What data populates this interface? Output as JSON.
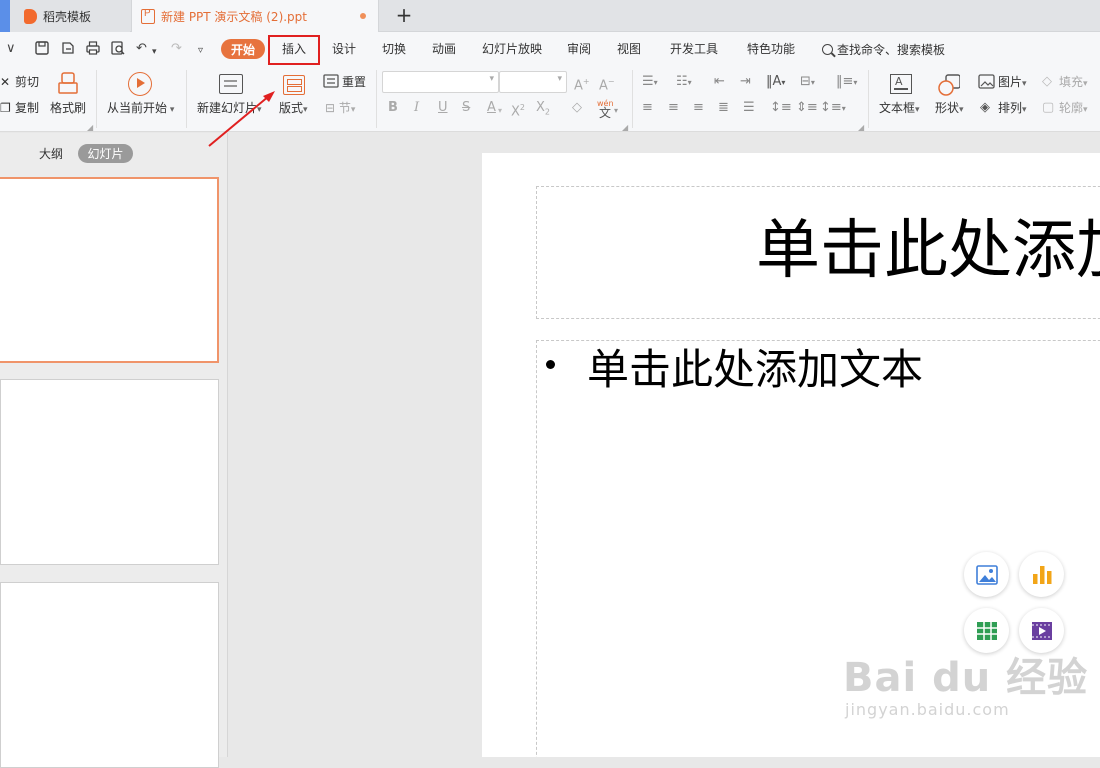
{
  "tabs": [
    {
      "label": "稻壳模板",
      "icon": "daoke-logo-icon"
    },
    {
      "label": "新建 PPT 演示文稿 (2).ppt",
      "icon": "ppt-file-icon",
      "active": true,
      "unsaved": true
    }
  ],
  "menu": {
    "items": [
      "开始",
      "插入",
      "设计",
      "切换",
      "动画",
      "幻灯片放映",
      "审阅",
      "视图",
      "开发工具",
      "特色功能"
    ],
    "active": "开始",
    "highlighted": "插入",
    "search_label": "查找命令、搜索模板"
  },
  "ribbon": {
    "cut": "剪切",
    "copy": "复制",
    "format_painter": "格式刷",
    "play_from_current": "从当前开始",
    "new_slide": "新建幻灯片",
    "layout": "版式",
    "reset": "重置",
    "section": "节",
    "textbox": "文本框",
    "shape": "形状",
    "picture": "图片",
    "arrange": "排列",
    "fill": "填充",
    "outline": "轮廓",
    "pinyin": "wén"
  },
  "left_panel": {
    "tab_outline": "大纲",
    "tab_slides": "幻灯片"
  },
  "slide": {
    "title_placeholder": "单击此处添加标题",
    "body_placeholder": "单击此处添加文本"
  },
  "watermark": {
    "main": "Bai du 经验",
    "sub": "jingyan.baidu.com"
  },
  "colors": {
    "accent": "#e7733e",
    "highlight_box": "#e02020",
    "arrow": "#e02020"
  }
}
